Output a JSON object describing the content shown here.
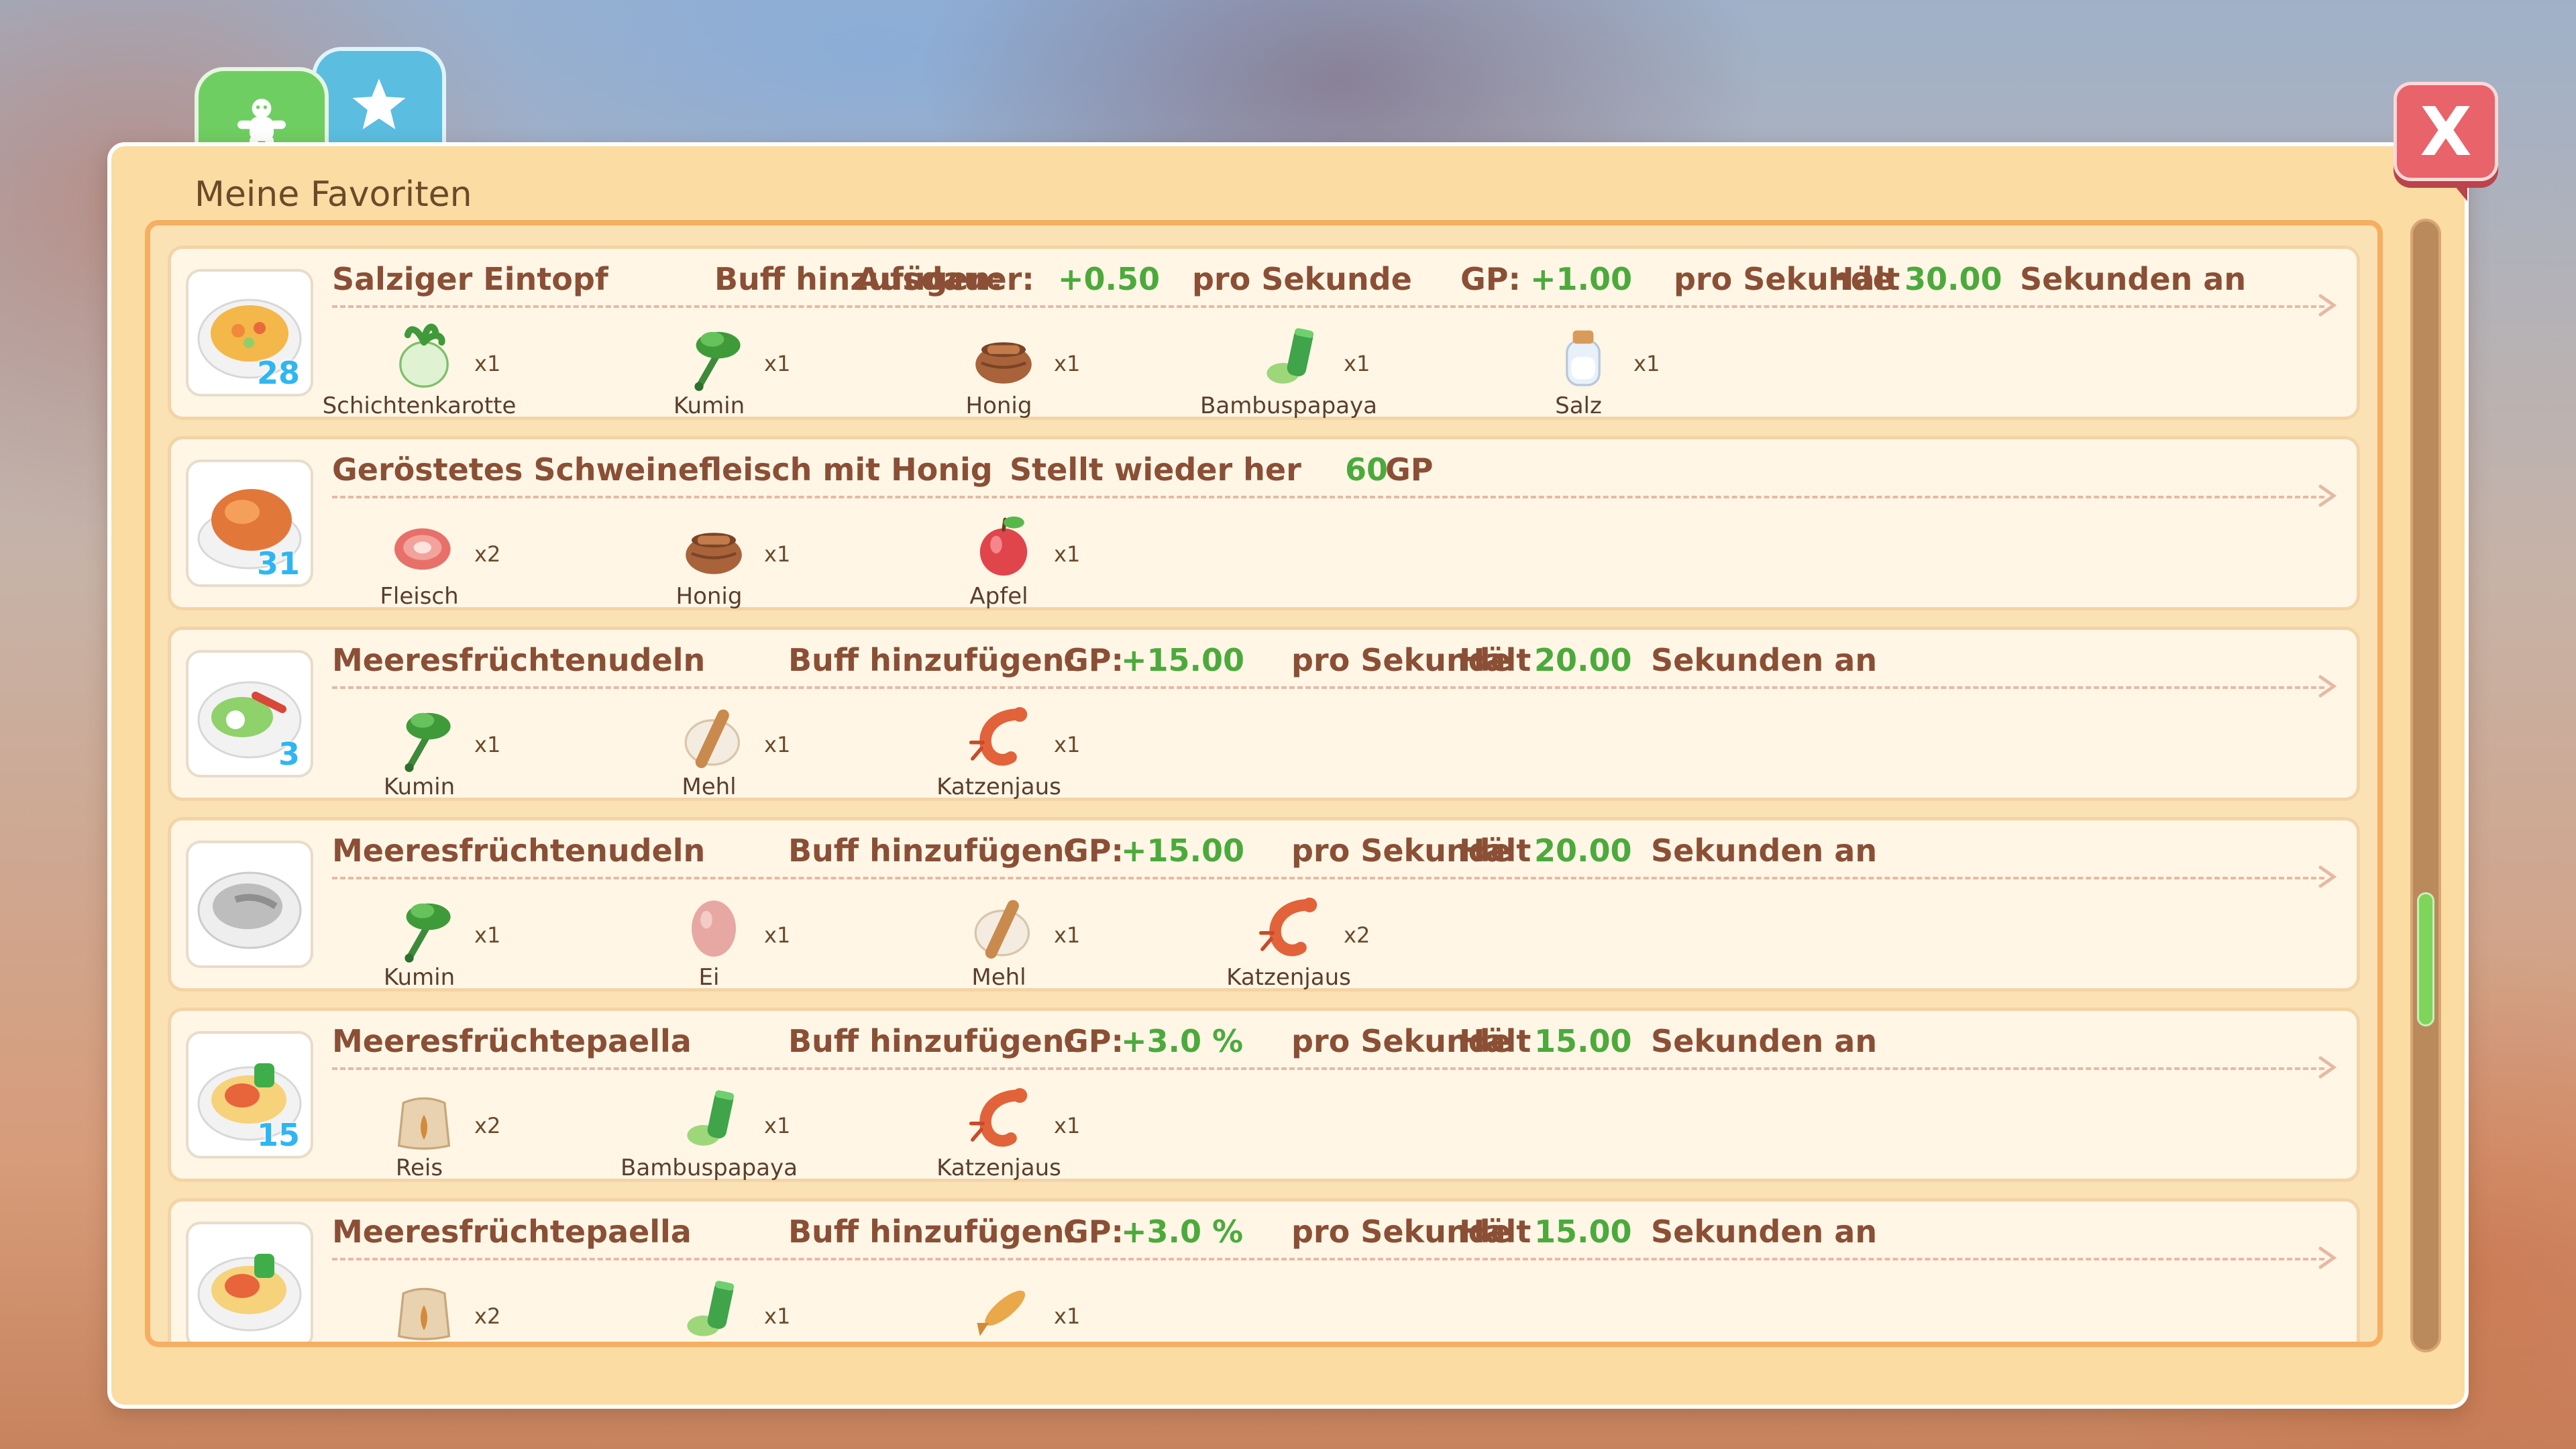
{
  "tabs": [
    {
      "icon": "gingerbread-icon",
      "color": "#6fce62"
    },
    {
      "icon": "star-icon",
      "color": "#5bbde0"
    }
  ],
  "panel": {
    "title": "Meine Favoriten",
    "close_label": "X"
  },
  "colors": {
    "accent_green": "#4caa3c",
    "title_brown": "#8a4f35",
    "count_blue": "#2fb6f2"
  },
  "recipes": [
    {
      "name": "Salziger Eintopf",
      "count": "28",
      "buff_label": "Buff hinzufügen:",
      "stat1_label": "Ausdauer:",
      "stat1_value": "+0.50",
      "stat1_unit": "pro Sekunde",
      "stat2_label": "GP:",
      "stat2_value": "+1.00",
      "stat2_unit": "pro Sekunde",
      "dur_label": "Hält",
      "dur_value": "30.00",
      "dur_unit": "Sekunden an",
      "ingredients": [
        {
          "name": "Schichtenkarotte",
          "qty": "x1",
          "icon": "turnip-icon"
        },
        {
          "name": "Kumin",
          "qty": "x1",
          "icon": "cumin-icon"
        },
        {
          "name": "Honig",
          "qty": "x1",
          "icon": "honey-pot-icon"
        },
        {
          "name": "Bambuspapaya",
          "qty": "x1",
          "icon": "bamboo-papaya-icon"
        },
        {
          "name": "Salz",
          "qty": "x1",
          "icon": "salt-jar-icon"
        }
      ]
    },
    {
      "name": "Geröstetes Schweinefleisch mit Honig",
      "count": "31",
      "restore_label": "Stellt wieder her",
      "restore_value": "60",
      "restore_unit": "GP",
      "ingredients": [
        {
          "name": "Fleisch",
          "qty": "x2",
          "icon": "meat-icon"
        },
        {
          "name": "Honig",
          "qty": "x1",
          "icon": "honey-pot-icon"
        },
        {
          "name": "Apfel",
          "qty": "x1",
          "icon": "apple-icon"
        }
      ]
    },
    {
      "name": "Meeresfrüchtenudeln",
      "count": "3",
      "buff_label": "Buff hinzufügen:",
      "stat2_label": "GP:",
      "stat2_value": "+15.00",
      "stat2_unit": "pro Sekunde",
      "dur_label": "Hält",
      "dur_value": "20.00",
      "dur_unit": "Sekunden an",
      "ingredients": [
        {
          "name": "Kumin",
          "qty": "x1",
          "icon": "cumin-icon"
        },
        {
          "name": "Mehl",
          "qty": "x1",
          "icon": "flour-icon"
        },
        {
          "name": "Katzenjaus",
          "qty": "x1",
          "icon": "shrimp-icon"
        }
      ]
    },
    {
      "name": "Meeresfrüchtenudeln",
      "count": "",
      "buff_label": "Buff hinzufügen:",
      "stat2_label": "GP:",
      "stat2_value": "+15.00",
      "stat2_unit": "pro Sekunde",
      "dur_label": "Hält",
      "dur_value": "20.00",
      "dur_unit": "Sekunden an",
      "ingredients": [
        {
          "name": "Kumin",
          "qty": "x1",
          "icon": "cumin-icon"
        },
        {
          "name": "Ei",
          "qty": "x1",
          "icon": "egg-icon"
        },
        {
          "name": "Mehl",
          "qty": "x1",
          "icon": "flour-icon"
        },
        {
          "name": "Katzenjaus",
          "qty": "x2",
          "icon": "shrimp-icon"
        }
      ]
    },
    {
      "name": "Meeresfrüchtepaella",
      "count": "15",
      "buff_label": "Buff hinzufügen:",
      "stat2_label": "GP:",
      "stat2_value": "+3.0 %",
      "stat2_unit": "pro Sekunde",
      "dur_label": "Hält",
      "dur_value": "15.00",
      "dur_unit": "Sekunden an",
      "ingredients": [
        {
          "name": "Reis",
          "qty": "x2",
          "icon": "rice-sack-icon"
        },
        {
          "name": "Bambuspapaya",
          "qty": "x1",
          "icon": "bamboo-papaya-icon"
        },
        {
          "name": "Katzenjaus",
          "qty": "x1",
          "icon": "shrimp-icon"
        }
      ]
    },
    {
      "name": "Meeresfrüchtepaella",
      "count": "",
      "buff_label": "Buff hinzufügen:",
      "stat2_label": "GP:",
      "stat2_value": "+3.0 %",
      "stat2_unit": "pro Sekunde",
      "dur_label": "Hält",
      "dur_value": "15.00",
      "dur_unit": "Sekunden an",
      "ingredients": [
        {
          "name": "",
          "qty": "x2",
          "icon": "rice-sack-icon"
        },
        {
          "name": "",
          "qty": "x1",
          "icon": "bamboo-papaya-icon"
        },
        {
          "name": "",
          "qty": "x1",
          "icon": "fish-icon"
        }
      ]
    }
  ]
}
